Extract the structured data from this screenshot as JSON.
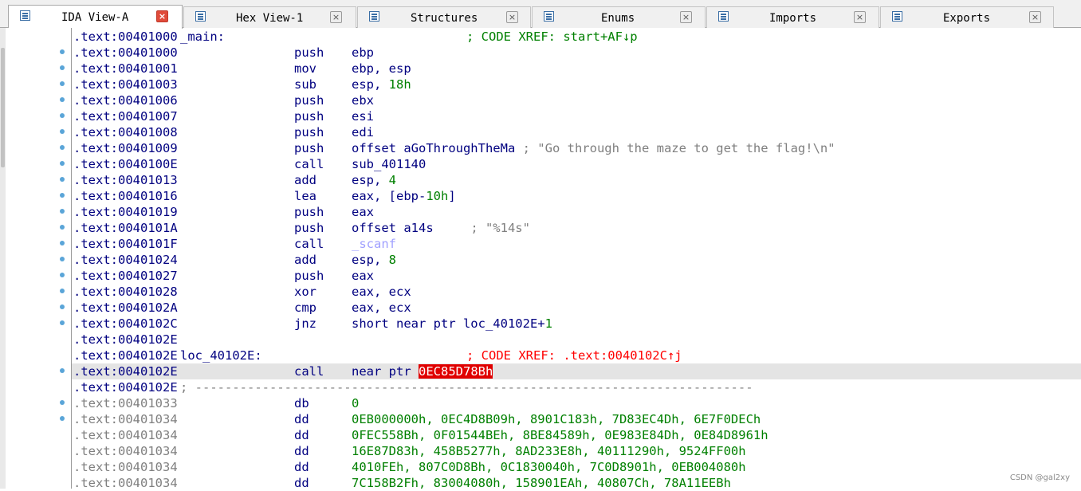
{
  "tabs": [
    {
      "label": "IDA View-A",
      "icon": "ida-view-icon",
      "active": true
    },
    {
      "label": "Hex View-1",
      "icon": "hex-view-icon",
      "active": false
    },
    {
      "label": "Structures",
      "icon": "structures-icon",
      "active": false
    },
    {
      "label": "Enums",
      "icon": "enums-icon",
      "active": false
    },
    {
      "label": "Imports",
      "icon": "imports-icon",
      "active": false
    },
    {
      "label": "Exports",
      "icon": "exports-icon",
      "active": false
    }
  ],
  "tab_close_glyph": "×",
  "listing": [
    {
      "addr": ".text:00401000",
      "label": "_main:",
      "xref": "; CODE XREF: start+AF↓p",
      "xref_color": "green"
    },
    {
      "addr": ".text:00401000",
      "mn": "push",
      "op": [
        [
          "ebp",
          "reg"
        ]
      ]
    },
    {
      "addr": ".text:00401001",
      "mn": "mov",
      "op": [
        [
          "ebp, esp",
          "reg"
        ]
      ]
    },
    {
      "addr": ".text:00401003",
      "mn": "sub",
      "op": [
        [
          "esp, ",
          "reg"
        ],
        [
          "18h",
          "num"
        ]
      ]
    },
    {
      "addr": ".text:00401006",
      "mn": "push",
      "op": [
        [
          "ebx",
          "reg"
        ]
      ]
    },
    {
      "addr": ".text:00401007",
      "mn": "push",
      "op": [
        [
          "esi",
          "reg"
        ]
      ]
    },
    {
      "addr": ".text:00401008",
      "mn": "push",
      "op": [
        [
          "edi",
          "reg"
        ]
      ]
    },
    {
      "addr": ".text:00401009",
      "mn": "push",
      "op": [
        [
          "offset aGoThroughTheMa",
          "name"
        ],
        [
          " ; \"Go through the maze to get the flag!\\n\"",
          "cm"
        ]
      ]
    },
    {
      "addr": ".text:0040100E",
      "mn": "call",
      "op": [
        [
          "sub_401140",
          "name"
        ]
      ]
    },
    {
      "addr": ".text:00401013",
      "mn": "add",
      "op": [
        [
          "esp, ",
          "reg"
        ],
        [
          "4",
          "num"
        ]
      ]
    },
    {
      "addr": ".text:00401016",
      "mn": "lea",
      "op": [
        [
          "eax, [ebp-",
          "reg"
        ],
        [
          "10h",
          "num"
        ],
        [
          "]",
          "reg"
        ]
      ]
    },
    {
      "addr": ".text:00401019",
      "mn": "push",
      "op": [
        [
          "eax",
          "reg"
        ]
      ]
    },
    {
      "addr": ".text:0040101A",
      "mn": "push",
      "op": [
        [
          "offset a14s",
          "name"
        ],
        [
          "     ; \"%14s\"",
          "cm"
        ]
      ]
    },
    {
      "addr": ".text:0040101F",
      "mn": "call",
      "op": [
        [
          "_scanf",
          "imp"
        ]
      ]
    },
    {
      "addr": ".text:00401024",
      "mn": "add",
      "op": [
        [
          "esp, ",
          "reg"
        ],
        [
          "8",
          "num"
        ]
      ]
    },
    {
      "addr": ".text:00401027",
      "mn": "push",
      "op": [
        [
          "eax",
          "reg"
        ]
      ]
    },
    {
      "addr": ".text:00401028",
      "mn": "xor",
      "op": [
        [
          "eax, ecx",
          "reg"
        ]
      ]
    },
    {
      "addr": ".text:0040102A",
      "mn": "cmp",
      "op": [
        [
          "eax, ecx",
          "reg"
        ]
      ]
    },
    {
      "addr": ".text:0040102C",
      "mn": "jnz",
      "op": [
        [
          "short near ptr loc_40102E+",
          "name"
        ],
        [
          "1",
          "num"
        ]
      ]
    },
    {
      "addr": ".text:0040102E"
    },
    {
      "addr": ".text:0040102E",
      "label": "loc_40102E:",
      "xref": "; CODE XREF: .text:0040102C↑j",
      "xref_color": "red"
    },
    {
      "addr": ".text:0040102E",
      "mn": "call",
      "op": [
        [
          "near ptr ",
          "name"
        ],
        [
          "0EC85D78Bh",
          "bad"
        ]
      ],
      "current": true
    },
    {
      "addr": ".text:0040102E",
      "dashes": "; ---------------------------------------------------------------------------"
    },
    {
      "addr": ".text:00401033",
      "grey": true,
      "mn": "db",
      "op": [
        [
          "0",
          "num"
        ]
      ]
    },
    {
      "addr": ".text:00401034",
      "grey": true,
      "mn": "dd",
      "op": [
        [
          "0EB000000h, 0EC4D8B09h, 8901C183h, 7D83EC4Dh, 6E7F0DECh",
          "num"
        ]
      ]
    },
    {
      "addr": ".text:00401034",
      "grey": true,
      "mn": "dd",
      "op": [
        [
          "0FEC558Bh, 0F01544BEh, 8BE84589h, 0E983E84Dh, 0E84D8961h",
          "num"
        ]
      ]
    },
    {
      "addr": ".text:00401034",
      "grey": true,
      "mn": "dd",
      "op": [
        [
          "16E87D83h, 458B5277h, 8AD233E8h, 40111290h, 9524FF00h",
          "num"
        ]
      ]
    },
    {
      "addr": ".text:00401034",
      "grey": true,
      "mn": "dd",
      "op": [
        [
          "4010FEh, 807C0D8Bh, 0C1830040h, 7C0D8901h, 0EB004080h",
          "num"
        ]
      ]
    },
    {
      "addr": ".text:00401034",
      "grey": true,
      "mn": "dd",
      "op": [
        [
          "7C158B2Fh, 83004080h, 158901EAh, 40807Ch, 78A11EEBh",
          "num"
        ]
      ]
    }
  ],
  "breakpoint_rows": [
    1,
    2,
    3,
    4,
    5,
    6,
    7,
    8,
    9,
    10,
    11,
    12,
    13,
    14,
    15,
    16,
    17,
    18,
    21,
    23,
    24
  ],
  "watermark": "CSDN @gal2xy",
  "colors": {
    "address": "#000080",
    "number": "#008000",
    "xref_red": "#ff0000",
    "xref_green": "#008000",
    "comment": "#7f7f7f",
    "import": "#a0a0ff",
    "bad_bg": "#e00000",
    "current_line": "#e4e4e4"
  }
}
